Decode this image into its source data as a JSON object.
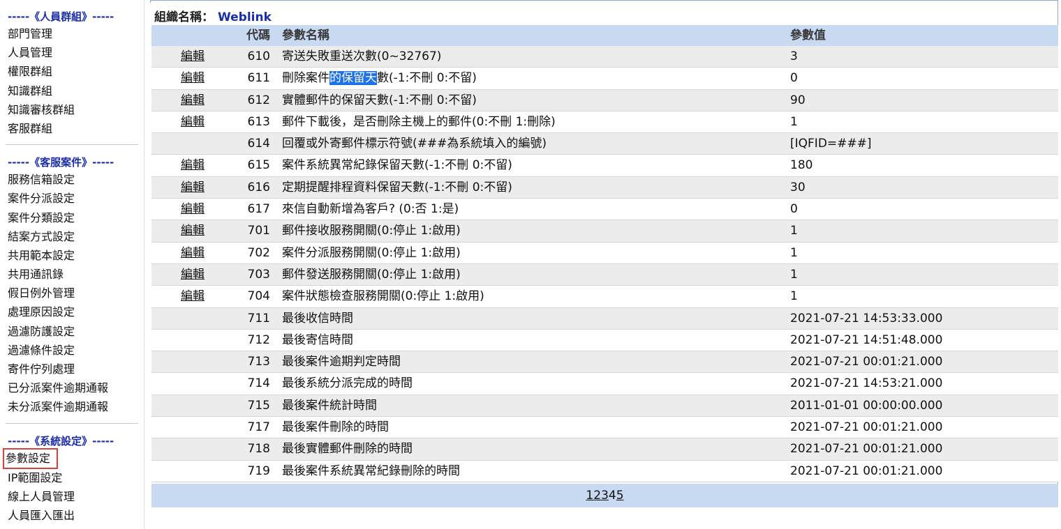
{
  "sidebar": {
    "sections": [
      {
        "header": "-----《人員群組》-----",
        "items": [
          "部門管理",
          "人員管理",
          "權限群組",
          "知識群組",
          "知識審核群組",
          "客服群組"
        ]
      },
      {
        "header": "-----《客服案件》-----",
        "items": [
          "服務信箱設定",
          "案件分派設定",
          "案件分類設定",
          "結案方式設定",
          "共用範本設定",
          "共用通訊錄",
          "假日例外管理",
          "處理原因設定",
          "過濾防護設定",
          "過濾條件設定",
          "寄件佇列處理",
          "已分派案件逾期通報",
          "未分派案件逾期通報"
        ]
      },
      {
        "header": "-----《系統設定》-----",
        "items": [
          "參數設定",
          "IP範圍設定",
          "線上人員管理",
          "人員匯入匯出"
        ]
      }
    ],
    "active_item": "參數設定"
  },
  "org": {
    "label": "組織名稱：",
    "name": "Weblink"
  },
  "table": {
    "headers": {
      "code": "代碼",
      "name": "參數名稱",
      "value": "參數值"
    },
    "edit_label": "編輯",
    "rows": [
      {
        "edit": true,
        "code": "610",
        "name": "寄送失敗重送次數(0~32767)",
        "value": "3"
      },
      {
        "edit": true,
        "code": "611",
        "name": "刪除案件的保留天數(-1:不刪 0:不留)",
        "value": "0"
      },
      {
        "edit": true,
        "code": "612",
        "name": "實體郵件的保留天數(-1:不刪 0:不留)",
        "value": "90"
      },
      {
        "edit": true,
        "code": "613",
        "name": "郵件下載後，是否刪除主機上的郵件(0:不刪 1:刪除)",
        "value": "1"
      },
      {
        "edit": false,
        "code": "614",
        "name": "回覆或外寄郵件標示符號(###為系統填入的編號)",
        "value": "[IQFID=###]"
      },
      {
        "edit": true,
        "code": "615",
        "name": "案件系統異常紀錄保留天數(-1:不刪 0:不留)",
        "value": "180"
      },
      {
        "edit": true,
        "code": "616",
        "name": "定期提醒排程資料保留天數(-1:不刪 0:不留)",
        "value": "30"
      },
      {
        "edit": true,
        "code": "617",
        "name": "來信自動新增為客戶? (0:否 1:是)",
        "value": "0"
      },
      {
        "edit": true,
        "code": "701",
        "name": "郵件接收服務開關(0:停止 1:啟用)",
        "value": "1"
      },
      {
        "edit": true,
        "code": "702",
        "name": "案件分派服務開關(0:停止 1:啟用)",
        "value": "1"
      },
      {
        "edit": true,
        "code": "703",
        "name": "郵件發送服務開關(0:停止 1:啟用)",
        "value": "1"
      },
      {
        "edit": true,
        "code": "704",
        "name": "案件狀態檢查服務開關(0:停止 1:啟用)",
        "value": "1"
      },
      {
        "edit": false,
        "code": "711",
        "name": "最後收信時間",
        "value": "2021-07-21 14:53:33.000"
      },
      {
        "edit": false,
        "code": "712",
        "name": "最後寄信時間",
        "value": "2021-07-21 14:51:48.000"
      },
      {
        "edit": false,
        "code": "713",
        "name": "最後案件逾期判定時間",
        "value": "2021-07-21 00:01:21.000"
      },
      {
        "edit": false,
        "code": "714",
        "name": "最後系統分派完成的時間",
        "value": "2021-07-21 14:53:21.000"
      },
      {
        "edit": false,
        "code": "715",
        "name": "最後案件統計時間",
        "value": "2011-01-01 00:00:00.000"
      },
      {
        "edit": false,
        "code": "717",
        "name": "最後案件刪除的時間",
        "value": "2021-07-21 00:01:21.000"
      },
      {
        "edit": false,
        "code": "718",
        "name": "最後實體郵件刪除的時間",
        "value": "2021-07-21 00:01:21.000"
      },
      {
        "edit": false,
        "code": "719",
        "name": "最後案件系統異常紀錄刪除的時間",
        "value": "2021-07-21 00:01:21.000"
      }
    ],
    "highlight": {
      "row_code": "611",
      "before": "刪除案件",
      "selected": "的保留天",
      "after": "數(-1:不刪 0:不留)"
    }
  },
  "pager": {
    "pages": [
      "1",
      "2",
      "3",
      "4",
      "5"
    ],
    "current": "4"
  },
  "colors": {
    "accent": "#1a2ea8",
    "header_bg": "#c8d9f2",
    "row_alt": "#ececec",
    "annotation_red": "#d9403a",
    "selection": "#1e72e8"
  }
}
